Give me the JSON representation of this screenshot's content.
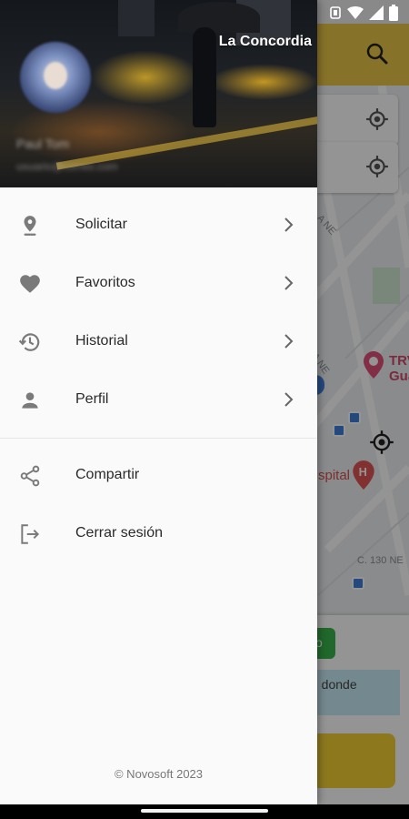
{
  "header": {
    "app_name": "La Concordia",
    "user_name": "Paul Tom",
    "user_email": "usuario@correo.com"
  },
  "menu": {
    "primary": [
      {
        "label": "Solicitar",
        "icon": "location-pin-icon"
      },
      {
        "label": "Favoritos",
        "icon": "heart-icon"
      },
      {
        "label": "Historial",
        "icon": "history-icon"
      },
      {
        "label": "Perfil",
        "icon": "person-icon"
      }
    ],
    "secondary": [
      {
        "label": "Compartir",
        "icon": "share-icon"
      },
      {
        "label": "Cerrar sesión",
        "icon": "logout-icon"
      }
    ]
  },
  "footer": {
    "copyright": "© Novosoft 2023"
  },
  "background": {
    "map_labels": [
      "A NE",
      "A NE",
      "C. 130 NE"
    ],
    "poi_label_1": "TRV Gua",
    "poi_label_2": "spital",
    "dest_partial": "n donde",
    "green_btn_partial": "o"
  },
  "colors": {
    "accent_yellow": "#e9c547",
    "drawer_bg": "#fafafa",
    "icon_gray": "#7a7a7a"
  }
}
